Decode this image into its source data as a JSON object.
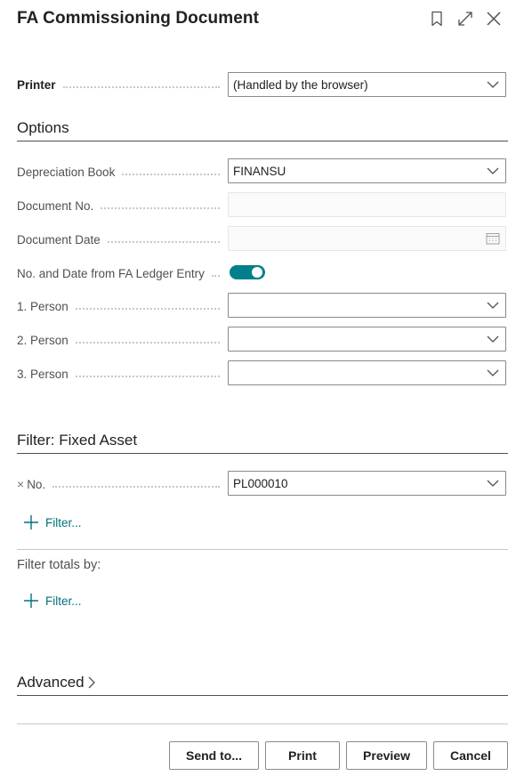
{
  "dialog": {
    "title": "FA Commissioning Document"
  },
  "printer": {
    "label": "Printer",
    "value": "(Handled by the browser)"
  },
  "options": {
    "heading": "Options",
    "depreciation_book": {
      "label": "Depreciation Book",
      "value": "FINANSU"
    },
    "document_no": {
      "label": "Document No.",
      "value": ""
    },
    "document_date": {
      "label": "Document Date",
      "value": ""
    },
    "no_date_from_ledger": {
      "label": "No. and Date from FA Ledger Entry",
      "checked": true
    },
    "person1": {
      "label": "1. Person",
      "value": ""
    },
    "person2": {
      "label": "2. Person",
      "value": ""
    },
    "person3": {
      "label": "3. Person",
      "value": ""
    }
  },
  "filter_fixed_asset": {
    "heading": "Filter: Fixed Asset",
    "no_filter": {
      "remove_glyph": "×",
      "label": "No.",
      "value": "PL000010"
    },
    "add_filter_label": "Filter..."
  },
  "filter_totals": {
    "label": "Filter totals by:",
    "add_filter_label": "Filter..."
  },
  "advanced": {
    "label": "Advanced"
  },
  "buttons": {
    "send_to": "Send to...",
    "print": "Print",
    "preview": "Preview",
    "cancel": "Cancel"
  },
  "colors": {
    "accent": "#00808a",
    "link": "#00737a"
  },
  "icons": [
    "bookmark-icon",
    "expand-icon",
    "close-icon",
    "chevron-down-icon",
    "calendar-icon",
    "plus-icon",
    "chevron-right-icon"
  ]
}
